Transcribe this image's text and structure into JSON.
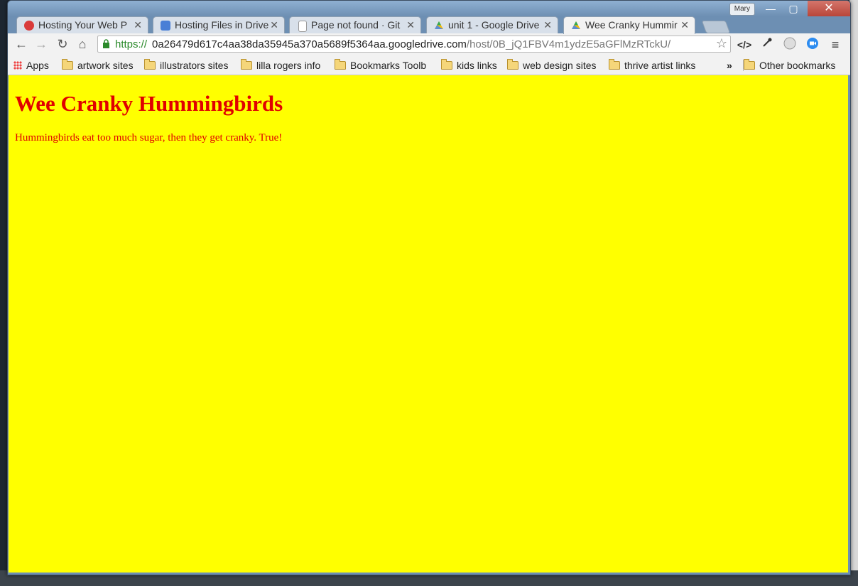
{
  "window": {
    "profile_name": "Mary",
    "controls": {
      "minimize": "—",
      "maximize": "▢",
      "close": "✕"
    }
  },
  "tabs": [
    {
      "title": "Hosting Your Web P",
      "favicon": "ga-icon",
      "color": "#d93b3b",
      "active": false
    },
    {
      "title": "Hosting Files in Drive",
      "favicon": "docs-icon",
      "color": "#4a7fd6",
      "active": false
    },
    {
      "title": "Page not found · Git",
      "favicon": "page-icon",
      "color": "#9a9a9a",
      "active": false
    },
    {
      "title": "unit 1 - Google Drive",
      "favicon": "drive-icon",
      "color": "#34a853",
      "active": false
    },
    {
      "title": "Wee Cranky Hummir",
      "favicon": "drive-icon",
      "color": "#34a853",
      "active": true
    }
  ],
  "toolbar": {
    "back": "←",
    "forward": "→",
    "reload": "↻",
    "home": "⌂",
    "url_scheme": "https://",
    "url_host": "0a26479d617c4aa38da35945a370a5689f5364aa.googledrive.com",
    "url_path": "/host/0B_jQ1FBV4m1ydzE5aGFlMzRTckU/",
    "star": "☆",
    "menu": "≡"
  },
  "bookmarks": {
    "apps": "Apps",
    "items": [
      "artwork sites",
      "illustrators sites",
      "lilla rogers info",
      "Bookmarks Toolb",
      "kids links",
      "web design sites",
      "thrive artist links"
    ],
    "overflow": "»",
    "other": "Other bookmarks"
  },
  "page": {
    "heading": "Wee Cranky Hummingbirds",
    "paragraph": "Hummingbirds eat too much sugar, then they get cranky. True!",
    "background": "#ffff00",
    "text_color": "#e00000"
  }
}
